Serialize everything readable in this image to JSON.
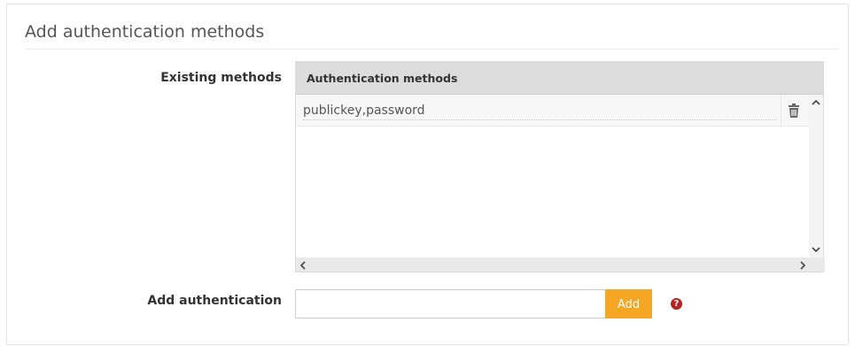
{
  "panel": {
    "title": "Add authentication methods"
  },
  "existing": {
    "label": "Existing methods",
    "grid": {
      "column_header": "Authentication methods",
      "rows": [
        {
          "value": "publickey,password"
        }
      ]
    }
  },
  "add": {
    "label": "Add authentication",
    "input_value": "",
    "button_label": "Add",
    "help_glyph": "?"
  },
  "icons": {
    "delete": "trash-icon",
    "help": "question-circle-icon"
  },
  "colors": {
    "accent": "#f5a623",
    "help": "#b22222",
    "header_bg": "#dcdcdc"
  }
}
